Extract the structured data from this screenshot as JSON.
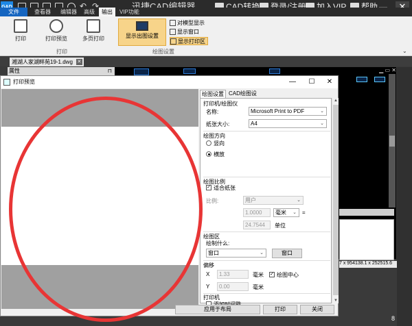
{
  "app": {
    "logo_text": "GAD",
    "title": "迅捷CAD编辑器",
    "top_links": [
      "CAD转换",
      "登录/注册",
      "加入VIP",
      "帮助"
    ],
    "minimize": "—",
    "close": "✕"
  },
  "menu": {
    "file": "文件",
    "tabs": [
      "查看器",
      "编辑器",
      "高级",
      "输出",
      "VIP功能"
    ]
  },
  "ribbon": {
    "print": "打印",
    "print_preview": "打印预览",
    "multi_print": "多页打印",
    "group_print": "打印",
    "show_settings": "显示出图设置",
    "model_show": "对模型显示",
    "show_window": "显示窗口",
    "show_print_area": "显示打印区",
    "group_draw": "绘图设置"
  },
  "document": {
    "tab_name": "湘湖人家湖畔苑19-1.dwg",
    "properties": "属性"
  },
  "status": {
    "coords": "7 x 954138.1 x 252515.6"
  },
  "tray": {
    "badge": "8"
  },
  "dialog": {
    "title": "打印预览",
    "tabs": [
      "绘图设置",
      "CAD绘图设置"
    ],
    "printer_section": "打印机/绘图仪",
    "name_label": "名称:",
    "printer_name": "Microsoft Print to PDF",
    "paper_label": "纸张大小:",
    "paper_size": "A4",
    "orientation_section": "绘图方向",
    "portrait": "竖向",
    "landscape": "横放",
    "orientation_selected": "landscape",
    "scale_section": "绘图比例",
    "fit_paper": "适合纸张",
    "fit_paper_checked": true,
    "scale_label": "比例:",
    "scale_value": "用户",
    "scale_num": "1.0000",
    "unit_mm": "毫米",
    "equals": "=",
    "scale_den": "24.7544",
    "unit_label": "单位",
    "area_section": "绘图区",
    "what_to_draw": "绘制什么:",
    "area_value": "窗口",
    "window_button": "窗口",
    "offset_section": "偏移",
    "x_label": "X",
    "x_value": "1.33",
    "y_label": "Y",
    "y_value": "0.00",
    "mm_x": "毫米",
    "mm_y": "毫米",
    "center": "绘图中心",
    "center_checked": true,
    "printer2_section": "打印机",
    "add_timestamp": "添加时间戳",
    "add_timestamp_checked": false,
    "apply_layout": "应用于布局",
    "print_button": "打印",
    "close_button": "关闭"
  },
  "colors": {
    "annotation_ring": "#e83535",
    "accent": "#1565c0",
    "highlight": "#f7d48a"
  }
}
